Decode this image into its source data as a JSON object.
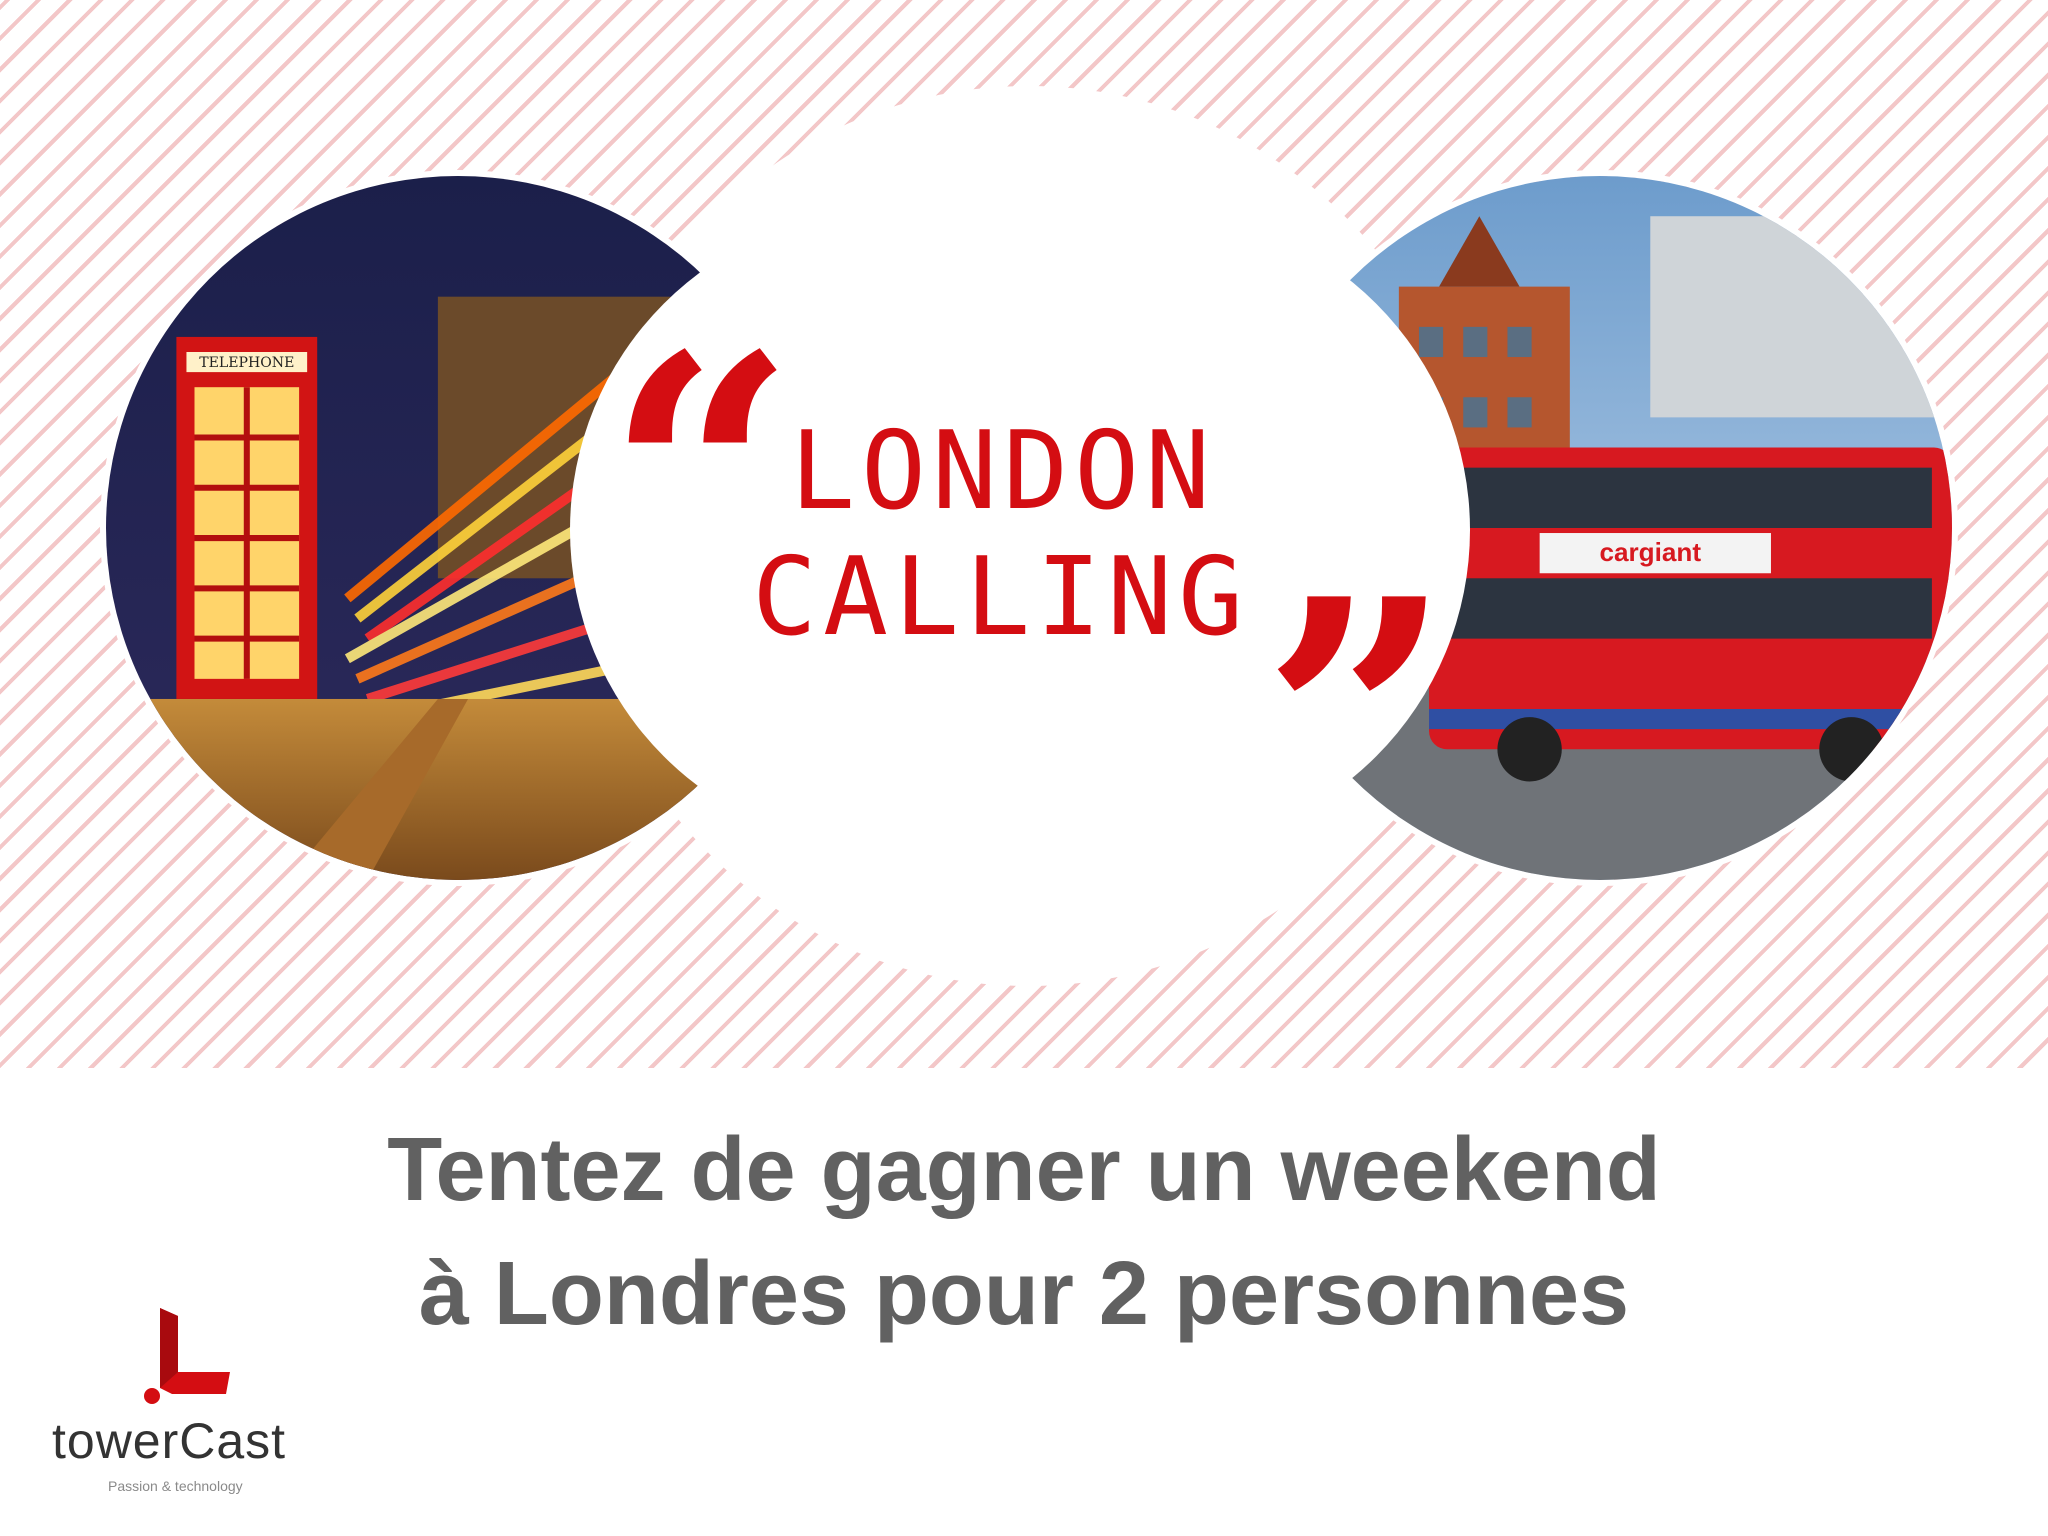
{
  "headline": {
    "line1": "LONDON",
    "line2": "CALLING"
  },
  "quotes": {
    "open": "“",
    "close": "”"
  },
  "photos": {
    "left": "photo-telephone-booth",
    "right": "photo-double-decker-bus",
    "left_sign": "TELEPHONE",
    "right_ad_text": "cargiant"
  },
  "promo": {
    "line1": "Tentez de gagner un weekend",
    "line2": "à Londres pour 2 personnes"
  },
  "brand": {
    "name": "towerCast",
    "tagline": "Passion & technology",
    "logo_icon": "towercast-logo-icon"
  },
  "colors": {
    "accent": "#d40d12",
    "stripe": "#f3c7c8",
    "text": "#616161"
  }
}
